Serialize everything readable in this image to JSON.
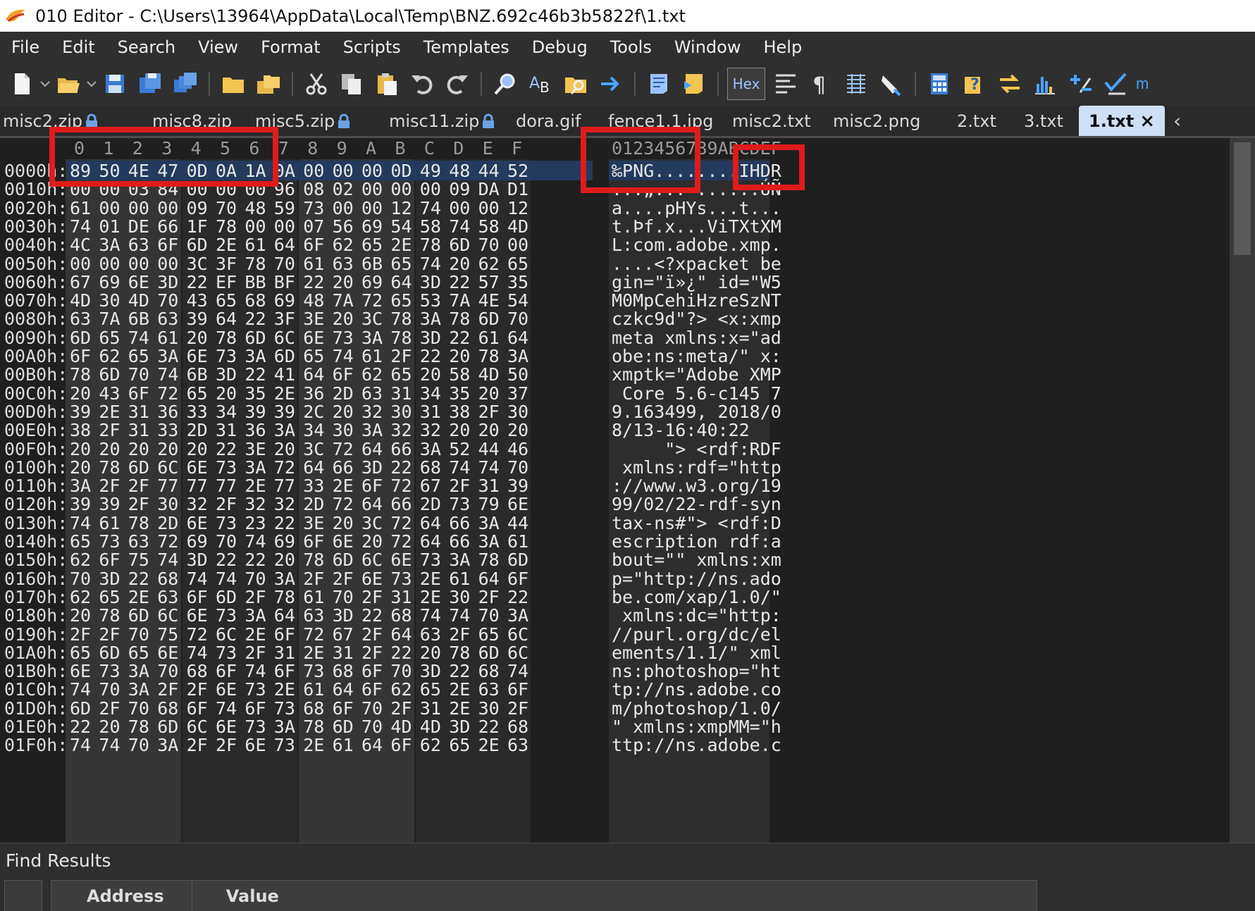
{
  "window": {
    "title": "010 Editor - C:\\Users\\13964\\AppData\\Local\\Temp\\BNZ.692c46b3b5822f\\1.txt"
  },
  "menu": [
    "File",
    "Edit",
    "Search",
    "View",
    "Format",
    "Scripts",
    "Templates",
    "Debug",
    "Tools",
    "Window",
    "Help"
  ],
  "toolbar": {
    "hex_label": "Hex",
    "more_label": "m"
  },
  "tabs": [
    {
      "label": "misc2.zip",
      "locked": true
    },
    {
      "label": "misc8.zip",
      "locked": false
    },
    {
      "label": "misc5.zip",
      "locked": true
    },
    {
      "label": "misc11.zip",
      "locked": true
    },
    {
      "label": "dora.gif",
      "locked": false
    },
    {
      "label": "fence1.1.jpg",
      "locked": false
    },
    {
      "label": "misc2.txt",
      "locked": false
    },
    {
      "label": "misc2.png",
      "locked": false
    },
    {
      "label": "2.txt",
      "locked": false
    },
    {
      "label": "3.txt",
      "locked": false
    },
    {
      "label": "1.txt",
      "locked": false,
      "active": true
    }
  ],
  "hexview": {
    "column_header_hex": [
      "0",
      "1",
      "2",
      "3",
      "4",
      "5",
      "6",
      "7",
      "8",
      "9",
      "A",
      "B",
      "C",
      "D",
      "E",
      "F"
    ],
    "column_header_ascii": "0123456789ABCDEF",
    "rows": [
      {
        "addr": "0000h:",
        "hex": "89 50 4E 47 0D 0A 1A 0A 00 00 00 0D 49 48 44 52",
        "ascii": "‰PNG........IHDR"
      },
      {
        "addr": "0010h:",
        "hex": "00 00 03 84 00 00 00 96 08 02 00 00 00 09 DA D1",
        "ascii": "...„...–......ÚÑ"
      },
      {
        "addr": "0020h:",
        "hex": "61 00 00 00 09 70 48 59 73 00 00 12 74 00 00 12",
        "ascii": "a....pHYs...t..."
      },
      {
        "addr": "0030h:",
        "hex": "74 01 DE 66 1F 78 00 00 07 56 69 54 58 74 58 4D",
        "ascii": "t.Þf.x...ViTXtXM"
      },
      {
        "addr": "0040h:",
        "hex": "4C 3A 63 6F 6D 2E 61 64 6F 62 65 2E 78 6D 70 00",
        "ascii": "L:com.adobe.xmp."
      },
      {
        "addr": "0050h:",
        "hex": "00 00 00 00 3C 3F 78 70 61 63 6B 65 74 20 62 65",
        "ascii": "....<?xpacket be"
      },
      {
        "addr": "0060h:",
        "hex": "67 69 6E 3D 22 EF BB BF 22 20 69 64 3D 22 57 35",
        "ascii": "gin=\"ï»¿\" id=\"W5"
      },
      {
        "addr": "0070h:",
        "hex": "4D 30 4D 70 43 65 68 69 48 7A 72 65 53 7A 4E 54",
        "ascii": "M0MpCehiHzreSzNT"
      },
      {
        "addr": "0080h:",
        "hex": "63 7A 6B 63 39 64 22 3F 3E 20 3C 78 3A 78 6D 70",
        "ascii": "czkc9d\"?> <x:xmp"
      },
      {
        "addr": "0090h:",
        "hex": "6D 65 74 61 20 78 6D 6C 6E 73 3A 78 3D 22 61 64",
        "ascii": "meta xmlns:x=\"ad"
      },
      {
        "addr": "00A0h:",
        "hex": "6F 62 65 3A 6E 73 3A 6D 65 74 61 2F 22 20 78 3A",
        "ascii": "obe:ns:meta/\" x:"
      },
      {
        "addr": "00B0h:",
        "hex": "78 6D 70 74 6B 3D 22 41 64 6F 62 65 20 58 4D 50",
        "ascii": "xmptk=\"Adobe XMP"
      },
      {
        "addr": "00C0h:",
        "hex": "20 43 6F 72 65 20 35 2E 36 2D 63 31 34 35 20 37",
        "ascii": " Core 5.6-c145 7"
      },
      {
        "addr": "00D0h:",
        "hex": "39 2E 31 36 33 34 39 39 2C 20 32 30 31 38 2F 30",
        "ascii": "9.163499, 2018/0"
      },
      {
        "addr": "00E0h:",
        "hex": "38 2F 31 33 2D 31 36 3A 34 30 3A 32 32 20 20 20",
        "ascii": "8/13-16:40:22   "
      },
      {
        "addr": "00F0h:",
        "hex": "20 20 20 20 20 22 3E 20 3C 72 64 66 3A 52 44 46",
        "ascii": "     \"> <rdf:RDF"
      },
      {
        "addr": "0100h:",
        "hex": "20 78 6D 6C 6E 73 3A 72 64 66 3D 22 68 74 74 70",
        "ascii": " xmlns:rdf=\"http"
      },
      {
        "addr": "0110h:",
        "hex": "3A 2F 2F 77 77 77 2E 77 33 2E 6F 72 67 2F 31 39",
        "ascii": "://www.w3.org/19"
      },
      {
        "addr": "0120h:",
        "hex": "39 39 2F 30 32 2F 32 32 2D 72 64 66 2D 73 79 6E",
        "ascii": "99/02/22-rdf-syn"
      },
      {
        "addr": "0130h:",
        "hex": "74 61 78 2D 6E 73 23 22 3E 20 3C 72 64 66 3A 44",
        "ascii": "tax-ns#\"> <rdf:D"
      },
      {
        "addr": "0140h:",
        "hex": "65 73 63 72 69 70 74 69 6F 6E 20 72 64 66 3A 61",
        "ascii": "escription rdf:a"
      },
      {
        "addr": "0150h:",
        "hex": "62 6F 75 74 3D 22 22 20 78 6D 6C 6E 73 3A 78 6D",
        "ascii": "bout=\"\" xmlns:xm"
      },
      {
        "addr": "0160h:",
        "hex": "70 3D 22 68 74 74 70 3A 2F 2F 6E 73 2E 61 64 6F",
        "ascii": "p=\"http://ns.ado"
      },
      {
        "addr": "0170h:",
        "hex": "62 65 2E 63 6F 6D 2F 78 61 70 2F 31 2E 30 2F 22",
        "ascii": "be.com/xap/1.0/\""
      },
      {
        "addr": "0180h:",
        "hex": "20 78 6D 6C 6E 73 3A 64 63 3D 22 68 74 74 70 3A",
        "ascii": " xmlns:dc=\"http:"
      },
      {
        "addr": "0190h:",
        "hex": "2F 2F 70 75 72 6C 2E 6F 72 67 2F 64 63 2F 65 6C",
        "ascii": "//purl.org/dc/el"
      },
      {
        "addr": "01A0h:",
        "hex": "65 6D 65 6E 74 73 2F 31 2E 31 2F 22 20 78 6D 6C",
        "ascii": "ements/1.1/\" xml"
      },
      {
        "addr": "01B0h:",
        "hex": "6E 73 3A 70 68 6F 74 6F 73 68 6F 70 3D 22 68 74",
        "ascii": "ns:photoshop=\"ht"
      },
      {
        "addr": "01C0h:",
        "hex": "74 70 3A 2F 2F 6E 73 2E 61 64 6F 62 65 2E 63 6F",
        "ascii": "tp://ns.adobe.co"
      },
      {
        "addr": "01D0h:",
        "hex": "6D 2F 70 68 6F 74 6F 73 68 6F 70 2F 31 2E 30 2F",
        "ascii": "m/photoshop/1.0/"
      },
      {
        "addr": "01E0h:",
        "hex": "22 20 78 6D 6C 6E 73 3A 78 6D 70 4D 4D 3D 22 68",
        "ascii": "\" xmlns:xmpMM=\"h"
      },
      {
        "addr": "01F0h:",
        "hex": "74 74 70 3A 2F 2F 6E 73 2E 61 64 6F 62 65 2E 63",
        "ascii": "ttp://ns.adobe.c"
      }
    ]
  },
  "find_results": {
    "title": "Find Results",
    "columns": [
      "Address",
      "Value"
    ]
  },
  "colors": {
    "annotation_red": "#e01b1b",
    "active_tab": "#cfe0f5",
    "hex_group_a": "#2a2a2a",
    "hex_group_b": "#353535"
  }
}
